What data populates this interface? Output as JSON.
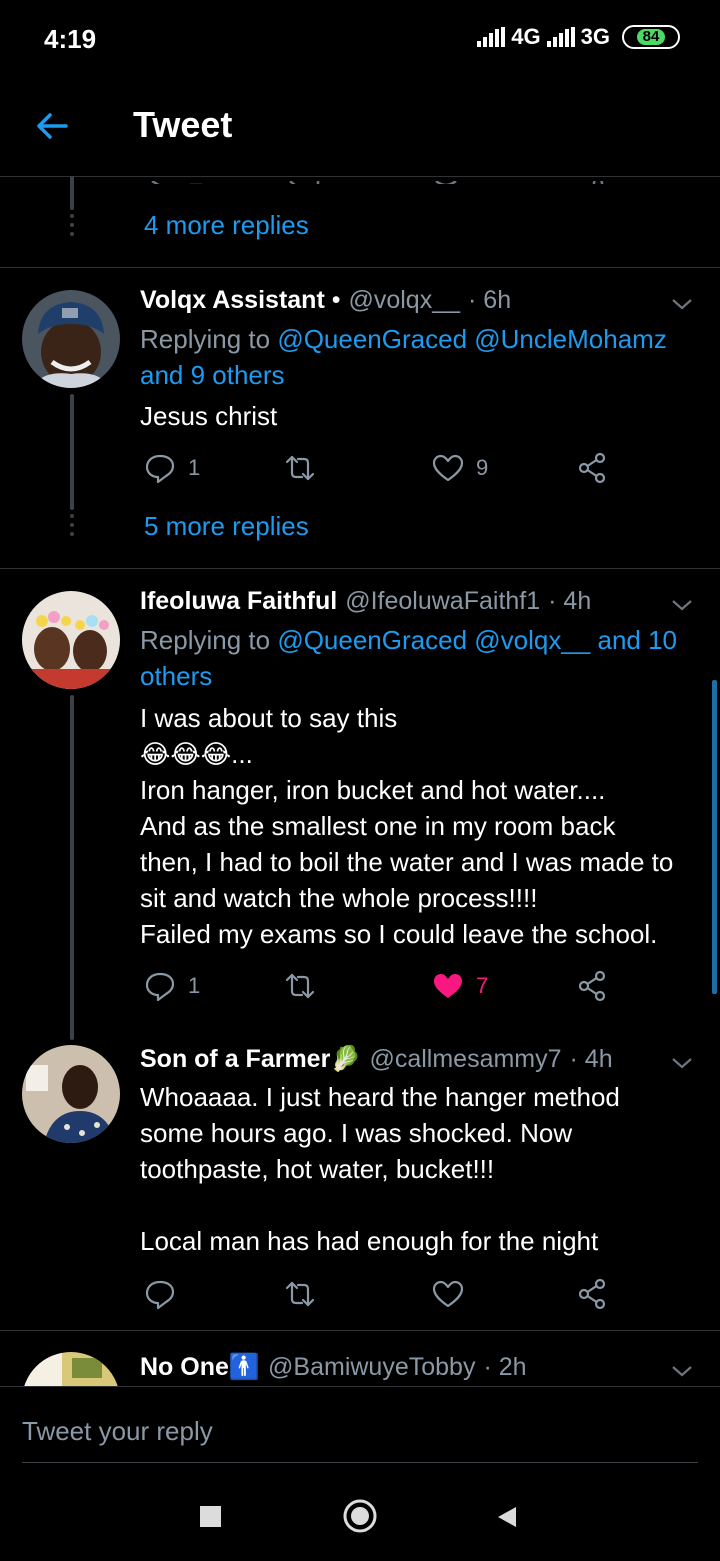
{
  "status_bar": {
    "time": "4:19",
    "network1": "4G",
    "network2": "3G",
    "battery": "84"
  },
  "header": {
    "title": "Tweet"
  },
  "thread_top": {
    "more_replies": "4 more replies"
  },
  "tweets": [
    {
      "name": "Volqx Assistant",
      "name_suffix": " •",
      "handle": "@volqx__",
      "time": "· 6h",
      "replying_prefix": "Replying to ",
      "replying_links": "@QueenGraced @UncleMohamz and 9 others",
      "text": "Jesus christ",
      "replies": "1",
      "retweets": "",
      "likes": "9",
      "liked": false,
      "more_replies": "5 more replies"
    },
    {
      "name": "Ifeoluwa Faithful",
      "handle": "@IfeoluwaFaithf1",
      "time": "· 4h",
      "replying_prefix": "Replying to ",
      "replying_links": "@QueenGraced @volqx__ and 10 others",
      "text_lines": [
        "I was about to say this",
        "😂😂😂...",
        "Iron hanger, iron bucket and hot water....",
        "And as the smallest one in my room back",
        "then, I had to boil the water and I was made to",
        "sit and watch the whole process!!!!",
        "Failed my exams so I could leave the school."
      ],
      "replies": "1",
      "retweets": "",
      "likes": "7",
      "liked": true
    },
    {
      "name": "Son of a Farmer🥬",
      "handle": "@callmesammy7",
      "time": "· 4h",
      "text_lines": [
        "Whoaaaa. I just heard the hanger method",
        "some hours ago. I was shocked. Now",
        "toothpaste, hot water, bucket!!!",
        "",
        "Local man has had enough for the night"
      ],
      "replies": "",
      "retweets": "",
      "likes": "",
      "liked": false
    },
    {
      "name": "No One🚹",
      "handle": "@BamiwuyeTobby",
      "time": "· 2h"
    }
  ],
  "composer": {
    "placeholder": "Tweet your reply"
  },
  "colors": {
    "accent": "#1d9bf0",
    "like": "#f91880",
    "muted": "#8b98a5",
    "background": "#000000"
  },
  "icons": [
    "back-arrow-icon",
    "reply-icon",
    "retweet-icon",
    "like-icon",
    "share-icon",
    "chevron-down-icon"
  ]
}
